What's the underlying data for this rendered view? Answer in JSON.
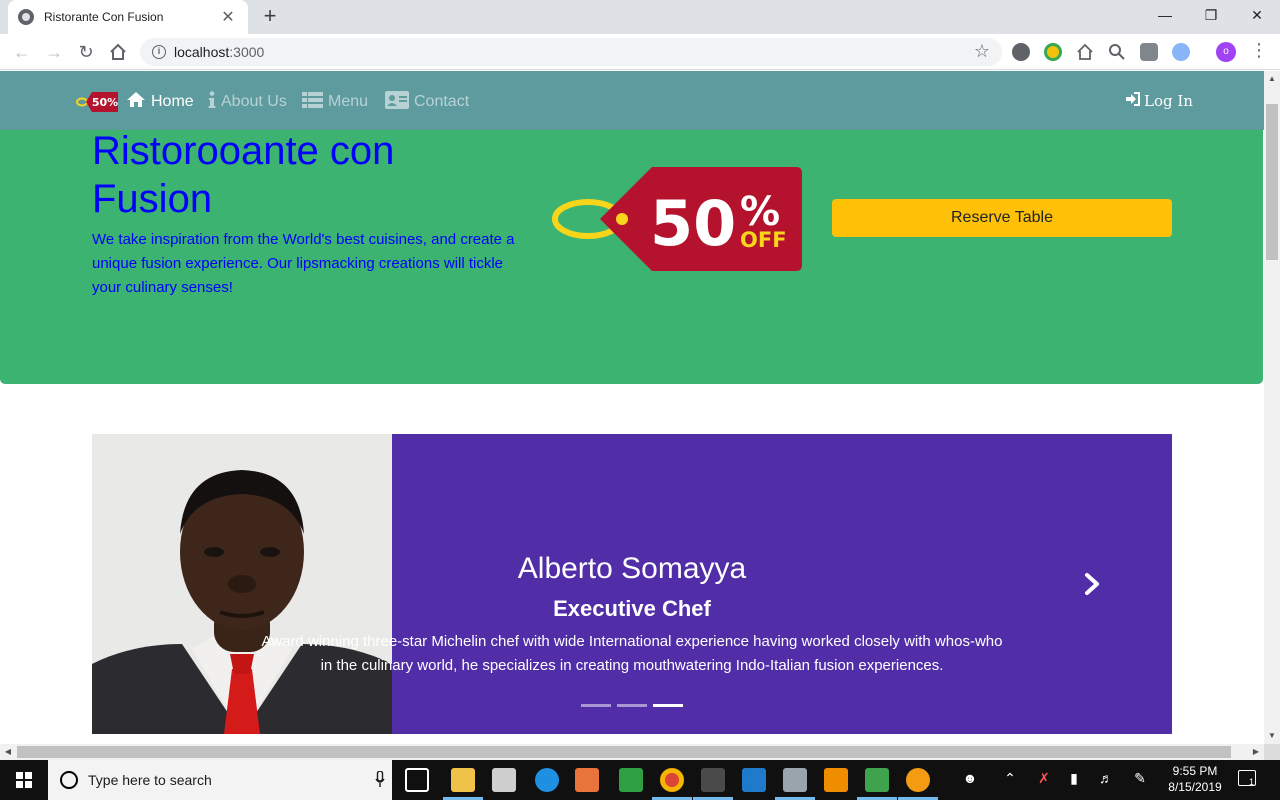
{
  "browser": {
    "tab_title": "Ristorante Con Fusion",
    "tab_close": "✕",
    "new_tab": "+",
    "url_host": "localhost",
    "url_port": ":3000",
    "window_min": "—",
    "window_restore": "❐",
    "window_close": "✕"
  },
  "nav": {
    "brand_badge": "50%",
    "items": [
      {
        "label": "Home",
        "icon": "home-icon",
        "active": true
      },
      {
        "label": "About Us",
        "icon": "info-icon",
        "active": false
      },
      {
        "label": "Menu",
        "icon": "list-icon",
        "active": false
      },
      {
        "label": "Contact",
        "icon": "address-card-icon",
        "active": false
      }
    ],
    "login_label": "Log In"
  },
  "jumbotron": {
    "title": "Ristorooante con Fusion",
    "description": "We take inspiration from the World's best cuisines, and create a unique fusion experience. Our lipsmacking creations will tickle your culinary senses!",
    "tag_value": "50",
    "tag_percent": "%",
    "tag_off": "OFF",
    "reserve_label": "Reserve Table"
  },
  "carousel": {
    "name": "Alberto Somayya",
    "role": "Executive Chef",
    "description": "Award winning three-star Michelin chef with wide International experience having worked closely with whos-who in the culinary world, he specializes in creating mouthwatering Indo-Italian fusion experiences.",
    "active_slide": 3,
    "slide_count": 3
  },
  "taskbar": {
    "search_placeholder": "Type here to search",
    "time": "9:55 PM",
    "date": "8/15/2019",
    "notification_count": "1"
  },
  "colors": {
    "navbar": "#5e9b9f",
    "jumbotron": "#3cb371",
    "heading_text": "#0000ff",
    "reserve_button": "#ffc107",
    "carousel_bg": "#512da8",
    "tag_red": "#b5122e",
    "tag_yellow": "#f7d51b"
  }
}
